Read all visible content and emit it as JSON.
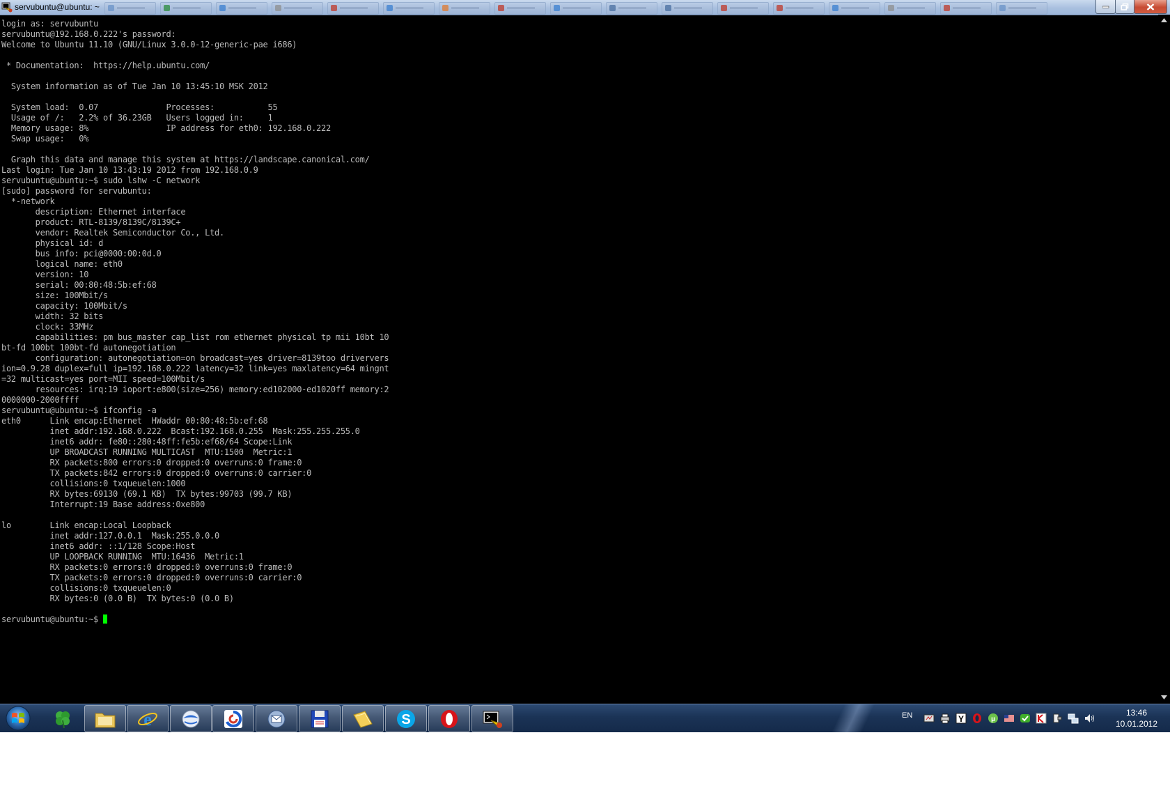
{
  "window": {
    "title": "servubuntu@ubuntu: ~"
  },
  "terminal": {
    "lines": [
      "login as: servubuntu",
      "servubuntu@192.168.0.222's password:",
      "Welcome to Ubuntu 11.10 (GNU/Linux 3.0.0-12-generic-pae i686)",
      "",
      " * Documentation:  https://help.ubuntu.com/",
      "",
      "  System information as of Tue Jan 10 13:45:10 MSK 2012",
      "",
      "  System load:  0.07              Processes:           55",
      "  Usage of /:   2.2% of 36.23GB   Users logged in:     1",
      "  Memory usage: 8%                IP address for eth0: 192.168.0.222",
      "  Swap usage:   0%",
      "",
      "  Graph this data and manage this system at https://landscape.canonical.com/",
      "Last login: Tue Jan 10 13:43:19 2012 from 192.168.0.9",
      "servubuntu@ubuntu:~$ sudo lshw -C network",
      "[sudo] password for servubuntu:",
      "  *-network",
      "       description: Ethernet interface",
      "       product: RTL-8139/8139C/8139C+",
      "       vendor: Realtek Semiconductor Co., Ltd.",
      "       physical id: d",
      "       bus info: pci@0000:00:0d.0",
      "       logical name: eth0",
      "       version: 10",
      "       serial: 00:80:48:5b:ef:68",
      "       size: 100Mbit/s",
      "       capacity: 100Mbit/s",
      "       width: 32 bits",
      "       clock: 33MHz",
      "       capabilities: pm bus_master cap_list rom ethernet physical tp mii 10bt 10",
      "bt-fd 100bt 100bt-fd autonegotiation",
      "       configuration: autonegotiation=on broadcast=yes driver=8139too driververs",
      "ion=0.9.28 duplex=full ip=192.168.0.222 latency=32 link=yes maxlatency=64 mingnt",
      "=32 multicast=yes port=MII speed=100Mbit/s",
      "       resources: irq:19 ioport:e800(size=256) memory:ed102000-ed1020ff memory:2",
      "0000000-2000ffff",
      "servubuntu@ubuntu:~$ ifconfig -a",
      "eth0      Link encap:Ethernet  HWaddr 00:80:48:5b:ef:68",
      "          inet addr:192.168.0.222  Bcast:192.168.0.255  Mask:255.255.255.0",
      "          inet6 addr: fe80::280:48ff:fe5b:ef68/64 Scope:Link",
      "          UP BROADCAST RUNNING MULTICAST  MTU:1500  Metric:1",
      "          RX packets:800 errors:0 dropped:0 overruns:0 frame:0",
      "          TX packets:842 errors:0 dropped:0 overruns:0 carrier:0",
      "          collisions:0 txqueuelen:1000",
      "          RX bytes:69130 (69.1 KB)  TX bytes:99703 (99.7 KB)",
      "          Interrupt:19 Base address:0xe800",
      "",
      "lo        Link encap:Local Loopback",
      "          inet addr:127.0.0.1  Mask:255.0.0.0",
      "          inet6 addr: ::1/128 Scope:Host",
      "          UP LOOPBACK RUNNING  MTU:16436  Metric:1",
      "          RX packets:0 errors:0 dropped:0 overruns:0 frame:0",
      "          TX packets:0 errors:0 dropped:0 overruns:0 carrier:0",
      "          collisions:0 txqueuelen:0",
      "          RX bytes:0 (0.0 B)  TX bytes:0 (0.0 B)",
      ""
    ],
    "prompt": "servubuntu@ubuntu:~$ ",
    "text_color": "#bbbbbb",
    "cursor_color": "#00ff00",
    "background": "#000000"
  },
  "taskbar": {
    "pinned": [
      {
        "name": "clover-app-icon",
        "active": false
      },
      {
        "name": "file-explorer-icon",
        "active": true
      },
      {
        "name": "internet-explorer-icon",
        "active": true
      },
      {
        "name": "globe-app-icon",
        "active": true
      },
      {
        "name": "browser-swirl-icon",
        "active": true
      },
      {
        "name": "mail-client-icon",
        "active": true
      },
      {
        "name": "floppy-save-icon",
        "active": true
      },
      {
        "name": "folder-icon",
        "active": true
      },
      {
        "name": "skype-icon",
        "active": true
      },
      {
        "name": "opera-icon",
        "active": true
      },
      {
        "name": "putty-icon",
        "active": true
      }
    ],
    "language": "EN",
    "tray_icons": [
      "network-monitor-icon",
      "printer-icon",
      "yandex-icon",
      "opera-tray-icon",
      "utorrent-icon",
      "us-flag-icon",
      "security-check-icon",
      "antivirus-icon",
      "usb-device-icon",
      "network-icon",
      "volume-icon"
    ],
    "clock_time": "13:46",
    "clock_date": "10.01.2012"
  }
}
